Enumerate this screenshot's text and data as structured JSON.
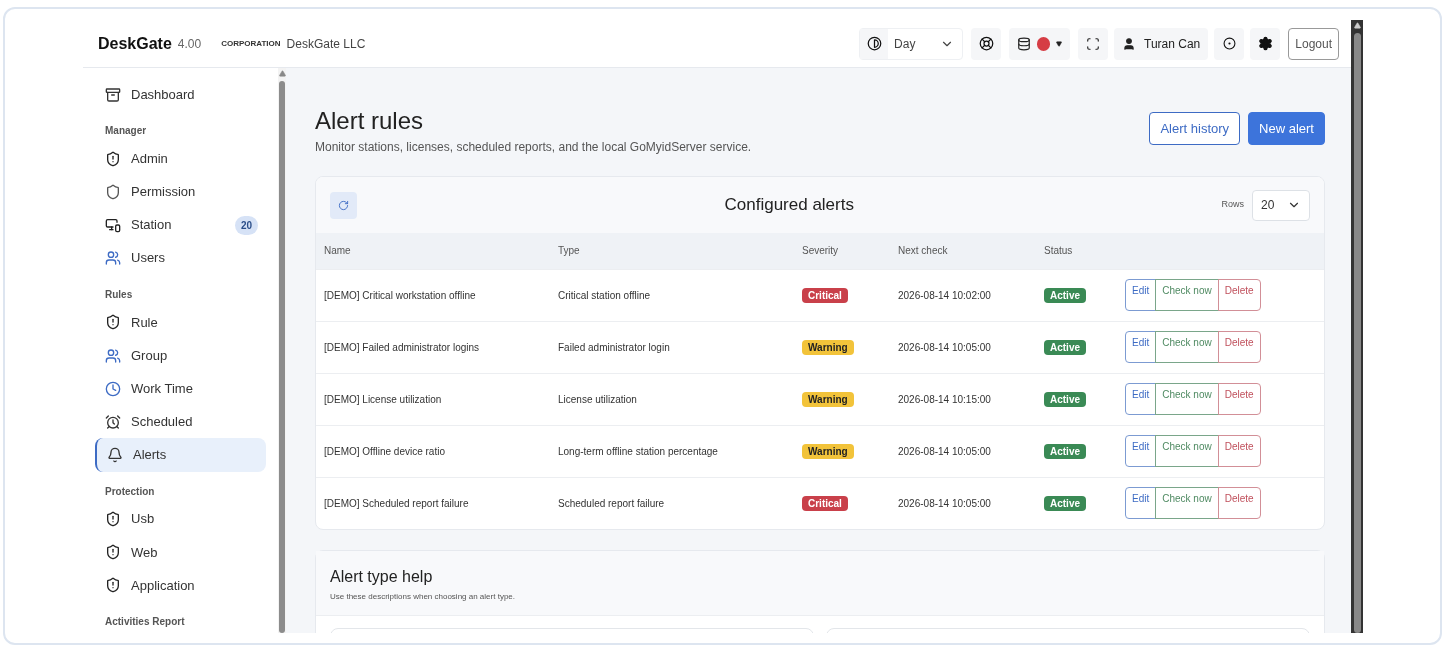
{
  "brand": {
    "name": "DeskGate",
    "version": "4.00",
    "corp_label": "CORPORATION",
    "corp_name": "DeskGate LLC"
  },
  "topbar": {
    "theme": "Day",
    "user": "Turan Can",
    "logout": "Logout"
  },
  "sidebar": [
    {
      "kind": "item",
      "label": "Dashboard",
      "selected": false
    },
    {
      "kind": "section",
      "label": "Manager"
    },
    {
      "kind": "item",
      "label": "Admin",
      "selected": false
    },
    {
      "kind": "item",
      "label": "Permission",
      "selected": false
    },
    {
      "kind": "item",
      "label": "Station",
      "selected": false,
      "badge": "20"
    },
    {
      "kind": "item",
      "label": "Users",
      "selected": false
    },
    {
      "kind": "section",
      "label": "Rules"
    },
    {
      "kind": "item",
      "label": "Rule",
      "selected": false
    },
    {
      "kind": "item",
      "label": "Group",
      "selected": false
    },
    {
      "kind": "item",
      "label": "Work Time",
      "selected": false
    },
    {
      "kind": "item",
      "label": "Scheduled",
      "selected": false
    },
    {
      "kind": "item",
      "label": "Alerts",
      "selected": true
    },
    {
      "kind": "section",
      "label": "Protection"
    },
    {
      "kind": "item",
      "label": "Usb",
      "selected": false
    },
    {
      "kind": "item",
      "label": "Web",
      "selected": false
    },
    {
      "kind": "item",
      "label": "Application",
      "selected": false
    },
    {
      "kind": "section",
      "label": "Activities Report"
    }
  ],
  "page": {
    "title": "Alert rules",
    "subtitle": "Monitor stations, licenses, scheduled reports, and the local GoMyidServer service.",
    "buttons": [
      {
        "kind": "outline",
        "label": "Alert history"
      },
      {
        "kind": "primary",
        "label": "New alert"
      }
    ]
  },
  "alerts_card": {
    "title": "Configured alerts",
    "rows_label": "Rows",
    "rows_value": "20",
    "columns": [
      "Name",
      "Type",
      "Severity",
      "Next check",
      "Status"
    ],
    "rows": [
      {
        "name": "[DEMO] Critical workstation offline",
        "type": "Critical station offline",
        "severity": {
          "kind": "critical",
          "label": "Critical"
        },
        "next_check": "2026-08-14 10:02:00",
        "status": {
          "kind": "active",
          "label": "Active"
        },
        "actions": [
          "Edit",
          "Check now",
          "Delete"
        ]
      },
      {
        "name": "[DEMO] Failed administrator logins",
        "type": "Failed administrator login",
        "severity": {
          "kind": "warning",
          "label": "Warning"
        },
        "next_check": "2026-08-14 10:05:00",
        "status": {
          "kind": "active",
          "label": "Active"
        },
        "actions": [
          "Edit",
          "Check now",
          "Delete"
        ]
      },
      {
        "name": "[DEMO] License utilization",
        "type": "License utilization",
        "severity": {
          "kind": "warning",
          "label": "Warning"
        },
        "next_check": "2026-08-14 10:15:00",
        "status": {
          "kind": "active",
          "label": "Active"
        },
        "actions": [
          "Edit",
          "Check now",
          "Delete"
        ]
      },
      {
        "name": "[DEMO] Offline device ratio",
        "type": "Long-term offline station percentage",
        "severity": {
          "kind": "warning",
          "label": "Warning"
        },
        "next_check": "2026-08-14 10:05:00",
        "status": {
          "kind": "active",
          "label": "Active"
        },
        "actions": [
          "Edit",
          "Check now",
          "Delete"
        ]
      },
      {
        "name": "[DEMO] Scheduled report failure",
        "type": "Scheduled report failure",
        "severity": {
          "kind": "critical",
          "label": "Critical"
        },
        "next_check": "2026-08-14 10:05:00",
        "status": {
          "kind": "active",
          "label": "Active"
        },
        "actions": [
          "Edit",
          "Check now",
          "Delete"
        ]
      }
    ]
  },
  "help_card": {
    "title": "Alert type help",
    "subtitle": "Use these descriptions when choosing an alert type."
  }
}
